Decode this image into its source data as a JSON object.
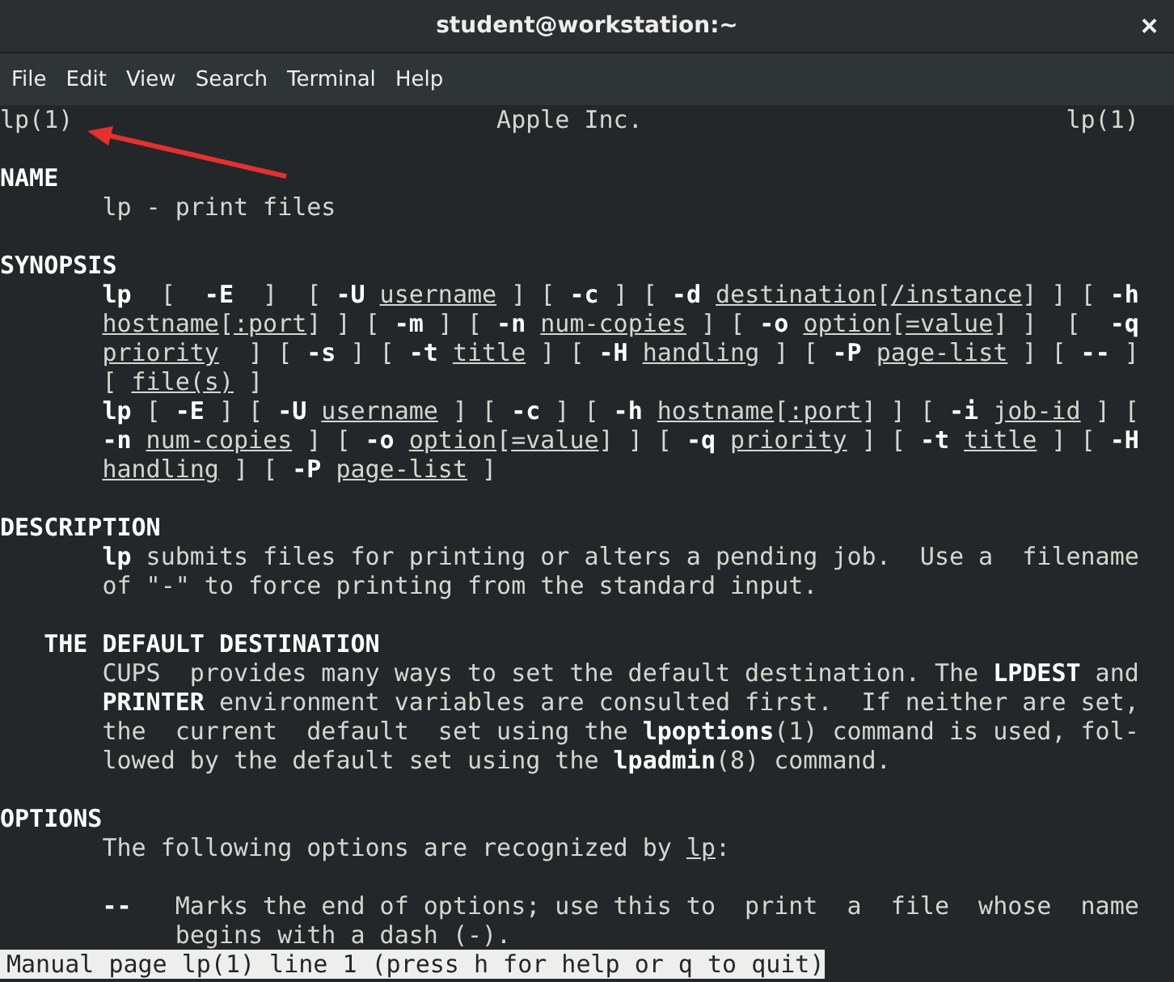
{
  "window": {
    "title": "student@workstation:~",
    "close": "×"
  },
  "menu": [
    "File",
    "Edit",
    "View",
    "Search",
    "Terminal",
    "Help"
  ],
  "header": {
    "left": "lp(1)",
    "center": "Apple Inc.",
    "right": "lp(1)"
  },
  "lines": [
    {
      "kind": "blank"
    },
    {
      "kind": "heading",
      "segments": [
        "NAME"
      ]
    },
    {
      "kind": "body",
      "segments": [
        "lp - print files"
      ]
    },
    {
      "kind": "blank"
    },
    {
      "kind": "heading",
      "segments": [
        "SYNOPSIS"
      ]
    },
    {
      "kind": "body",
      "segments": [
        {
          "kind": "bold",
          "text": "lp"
        },
        "  [  ",
        {
          "kind": "bold",
          "text": "-E"
        },
        "  ]  [ ",
        {
          "kind": "bold",
          "text": "-U "
        },
        {
          "kind": "underline",
          "text": "username"
        },
        " ] [ ",
        {
          "kind": "bold",
          "text": "-c"
        },
        " ] [ ",
        {
          "kind": "bold",
          "text": "-d "
        },
        {
          "kind": "underline",
          "text": "destination"
        },
        "[",
        {
          "kind": "underline",
          "text": "/instance"
        },
        "] ] [ ",
        {
          "kind": "bold",
          "text": "-h"
        }
      ]
    },
    {
      "kind": "body",
      "segments": [
        {
          "kind": "underline",
          "text": "hostname"
        },
        "[",
        {
          "kind": "underline",
          "text": ":port"
        },
        "] ] [ ",
        {
          "kind": "bold",
          "text": "-m"
        },
        " ] [ ",
        {
          "kind": "bold",
          "text": "-n "
        },
        {
          "kind": "underline",
          "text": "num-copies"
        },
        " ] [ ",
        {
          "kind": "bold",
          "text": "-o "
        },
        {
          "kind": "underline",
          "text": "option"
        },
        "[",
        {
          "kind": "underline",
          "text": "=value"
        },
        "] ]  [  ",
        {
          "kind": "bold",
          "text": "-q"
        }
      ]
    },
    {
      "kind": "body",
      "segments": [
        {
          "kind": "underline",
          "text": "priority"
        },
        "  ] [ ",
        {
          "kind": "bold",
          "text": "-s"
        },
        " ] [ ",
        {
          "kind": "bold",
          "text": "-t "
        },
        {
          "kind": "underline",
          "text": "title"
        },
        " ] [ ",
        {
          "kind": "bold",
          "text": "-H "
        },
        {
          "kind": "underline",
          "text": "handling"
        },
        " ] [ ",
        {
          "kind": "bold",
          "text": "-P "
        },
        {
          "kind": "underline",
          "text": "page-list"
        },
        " ] [ ",
        {
          "kind": "bold",
          "text": "--"
        },
        " ]"
      ]
    },
    {
      "kind": "body",
      "segments": [
        "[ ",
        {
          "kind": "underline",
          "text": "file(s)"
        },
        " ]"
      ]
    },
    {
      "kind": "body",
      "segments": [
        {
          "kind": "bold",
          "text": "lp"
        },
        " [ ",
        {
          "kind": "bold",
          "text": "-E"
        },
        " ] [ ",
        {
          "kind": "bold",
          "text": "-U "
        },
        {
          "kind": "underline",
          "text": "username"
        },
        " ] [ ",
        {
          "kind": "bold",
          "text": "-c"
        },
        " ] [ ",
        {
          "kind": "bold",
          "text": "-h "
        },
        {
          "kind": "underline",
          "text": "hostname"
        },
        "[",
        {
          "kind": "underline",
          "text": ":port"
        },
        "] ] [ ",
        {
          "kind": "bold",
          "text": "-i "
        },
        {
          "kind": "underline",
          "text": "job-id"
        },
        " ] ["
      ]
    },
    {
      "kind": "body",
      "segments": [
        {
          "kind": "bold",
          "text": "-n "
        },
        {
          "kind": "underline",
          "text": "num-copies"
        },
        " ] [ ",
        {
          "kind": "bold",
          "text": "-o "
        },
        {
          "kind": "underline",
          "text": "option"
        },
        "[",
        {
          "kind": "underline",
          "text": "=value"
        },
        "] ] [ ",
        {
          "kind": "bold",
          "text": "-q "
        },
        {
          "kind": "underline",
          "text": "priority"
        },
        " ] [ ",
        {
          "kind": "bold",
          "text": "-t "
        },
        {
          "kind": "underline",
          "text": "title"
        },
        " ] [ ",
        {
          "kind": "bold",
          "text": "-H"
        }
      ]
    },
    {
      "kind": "body",
      "segments": [
        {
          "kind": "underline",
          "text": "handling"
        },
        " ] [ ",
        {
          "kind": "bold",
          "text": "-P "
        },
        {
          "kind": "underline",
          "text": "page-list"
        },
        " ]"
      ]
    },
    {
      "kind": "blank"
    },
    {
      "kind": "heading",
      "segments": [
        "DESCRIPTION"
      ]
    },
    {
      "kind": "body",
      "segments": [
        {
          "kind": "bold",
          "text": "lp"
        },
        " submits files for printing or alters a pending job.  Use a  filename"
      ]
    },
    {
      "kind": "body",
      "segments": [
        "of \"-\" to force printing from the standard input."
      ]
    },
    {
      "kind": "blank"
    },
    {
      "kind": "subheading",
      "segments": [
        "THE DEFAULT DESTINATION"
      ]
    },
    {
      "kind": "body",
      "segments": [
        "CUPS  provides many ways to set the default destination. The ",
        {
          "kind": "bold",
          "text": "LPDEST"
        },
        " and"
      ]
    },
    {
      "kind": "body",
      "segments": [
        {
          "kind": "bold",
          "text": "PRINTER"
        },
        " environment variables are consulted first.  If neither are set,"
      ]
    },
    {
      "kind": "body",
      "segments": [
        "the  current  default  set using the ",
        {
          "kind": "bold",
          "text": "lpoptions"
        },
        "(1) command is used, fol-"
      ]
    },
    {
      "kind": "body",
      "segments": [
        "lowed by the default set using the ",
        {
          "kind": "bold",
          "text": "lpadmin"
        },
        "(8) command."
      ]
    },
    {
      "kind": "blank"
    },
    {
      "kind": "heading",
      "segments": [
        "OPTIONS"
      ]
    },
    {
      "kind": "body",
      "segments": [
        "The following options are recognized by ",
        {
          "kind": "underline",
          "text": "lp"
        },
        ":"
      ]
    },
    {
      "kind": "blank"
    },
    {
      "kind": "body",
      "segments": [
        {
          "kind": "bold",
          "text": "--"
        },
        "   Marks the end of options; use this to  print  a  file  whose  name"
      ]
    },
    {
      "kind": "hanging",
      "segments": [
        "begins with a dash (-)."
      ]
    }
  ],
  "status": "Manual page lp(1) line 1 (press h for help or q to quit)"
}
